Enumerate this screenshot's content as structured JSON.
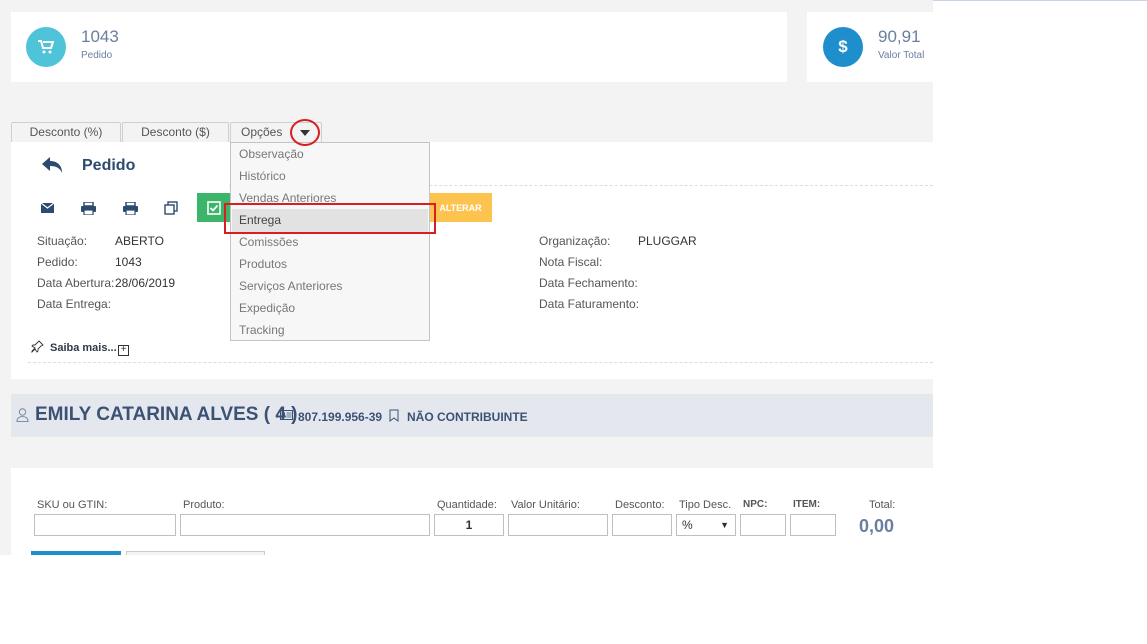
{
  "stats": {
    "pedido": {
      "value": "1043",
      "label": "Pedido",
      "icon": "cart-icon",
      "color": "#4fc3d7"
    },
    "valor": {
      "value": "90,91",
      "label": "Valor Total",
      "icon": "dollar-icon",
      "color": "#1e8fcc"
    }
  },
  "tabs": [
    "Desconto (%)",
    "Desconto ($)",
    "Opções"
  ],
  "header": {
    "title": "Pedido"
  },
  "actions": {
    "alterar_label": "ALTERAR",
    "alterar_color": "#fdc34f",
    "confirm_color": "#3bb56a"
  },
  "info": {
    "situacao_label": "Situação:",
    "situacao_value": "ABERTO",
    "pedido_label": "Pedido:",
    "pedido_value": "1043",
    "data_abertura_label": "Data Abertura:",
    "data_abertura_value": "28/06/2019",
    "data_entrega_label": "Data Entrega:",
    "organizacao_label": "Organização:",
    "organizacao_value": "PLUGGAR",
    "nota_fiscal_label": "Nota Fiscal:",
    "data_fechamento_label": "Data Fechamento:",
    "data_faturamento_label": "Data Faturamento:"
  },
  "saiba_mais": "Saiba mais...",
  "dropdown": {
    "items": [
      "Observação",
      "Histórico",
      "Vendas Anteriores",
      "Entrega",
      "Comissões",
      "Produtos",
      "Serviços Anteriores",
      "Expedição",
      "Tracking"
    ],
    "highlighted": "Entrega"
  },
  "customer": {
    "name": "EMILY CATARINA ALVES ( 4 )",
    "document": "807.199.956-39",
    "tax_status": "NÃO CONTRIBUINTE"
  },
  "form": {
    "sku_label": "SKU ou GTIN:",
    "produto_label": "Produto:",
    "quantidade_label": "Quantidade:",
    "quantidade_value": "1",
    "valor_unitario_label": "Valor Unitário:",
    "desconto_label": "Desconto:",
    "tipo_desc_label": "Tipo Desc.",
    "tipo_desc_value": "%",
    "npc_label": "NPC:",
    "item_label": "ITEM:",
    "total_label": "Total:",
    "total_value": "0,00"
  }
}
